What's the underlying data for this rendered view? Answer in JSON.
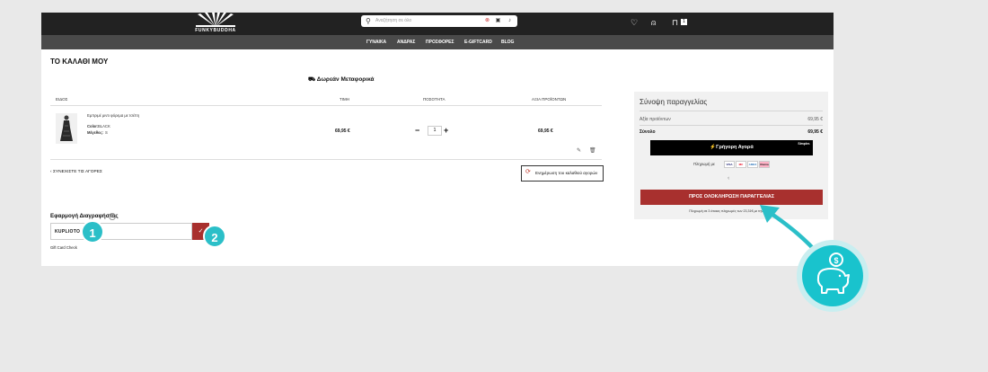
{
  "header": {
    "logo_text": "FUNKYBUDDHA",
    "search_placeholder": "Αναζήτηση σε όλο",
    "cart_count": "1"
  },
  "nav": {
    "items": [
      "ΓΥΝΑΙΚΑ",
      "ΑΝΔΡΑΣ",
      "ΠΡΟΣΦΟΡΕΣ",
      "E-GIFTCARD",
      "BLOG"
    ]
  },
  "cart": {
    "title": "ΤΟ ΚΑΛΑΘΙ ΜΟΥ",
    "free_shipping": "Δωρεάν Μεταφορικά",
    "columns": {
      "item": "ΕΙΔΟΣ",
      "price": "ΤΙΜΗ",
      "quantity": "ΠΟΣΟΤΗΤΑ",
      "total": "ΑΞΙΑ ΠΡΟΪΟΝΤΩΝ"
    },
    "item": {
      "name": "Εμπριμέ μιντι φόρεμα με τσέπη",
      "color_label": "Color:",
      "color_value": "BLACK",
      "size_label": "Μέγεθος:",
      "size_value": "S",
      "price": "69,95 €",
      "qty": "1",
      "total": "69,95 €"
    },
    "continue_label": "ΣΥΝΕΧΙΣΤΕ ΤΙΣ ΑΓΟΡΕΣ",
    "update_label": "Ενημέρωση του καλαθιού αγορών"
  },
  "coupon": {
    "title": "Εφαρμογή Διαγραφήστας",
    "value": "KUPLIOTO",
    "apply_icon": "check-icon",
    "gift_card_check": "Gift Card Check"
  },
  "summary": {
    "title": "Σύνοψη παραγγελίας",
    "subtotal_label": "Αξία προϊόντων",
    "subtotal_value": "69,95 €",
    "total_label": "Σύνολο",
    "total_value": "69,95 €",
    "express_label": "Γρήγορη Αγορά",
    "express_brand": "Simpler.",
    "pay_with": "Πληρωμή με",
    "or_text": "ή",
    "checkout_label": "ΠΡΟΣ ΟΛΟΚΛΗΡΩΣΗ ΠΑΡΑΓΓΕΛΙΑΣ",
    "klarna_text": "Πληρωμή σε 3 άτοκες πληρωμές των 23,31€ με την Klarna",
    "payment_methods": [
      "VISA",
      "MC",
      "AMEX",
      "Klarna"
    ]
  },
  "callouts": [
    "1",
    "2"
  ],
  "colors": {
    "brand_red": "#a8302e",
    "callout_teal": "#2bbfc8",
    "header_dark": "#222222"
  }
}
